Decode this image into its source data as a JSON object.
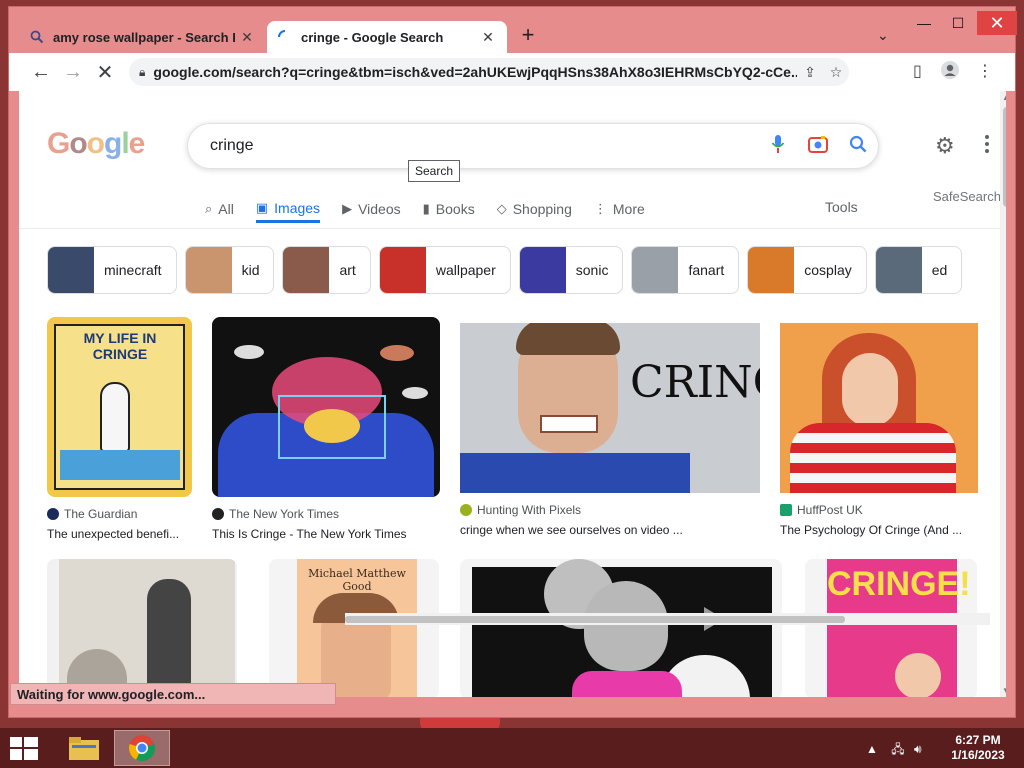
{
  "browser": {
    "tabs": [
      {
        "title": "amy rose wallpaper - Search I",
        "active": false
      },
      {
        "title": "cringe - Google Search",
        "active": true
      }
    ],
    "url": "google.com/search?q=cringe&tbm=isch&ved=2ahUKEwjPqqHSns38AhX8o3IEHRMsCbYQ2-cCe...",
    "status_text": "Waiting for www.google.com..."
  },
  "google": {
    "logo_letters": [
      "G",
      "o",
      "o",
      "g",
      "l",
      "e"
    ],
    "query": "cringe",
    "tooltip": "Search",
    "nav_tabs": [
      {
        "label": "All",
        "icon": "search-icon",
        "active": false
      },
      {
        "label": "Images",
        "icon": "image-icon",
        "active": true
      },
      {
        "label": "Videos",
        "icon": "video-icon",
        "active": false
      },
      {
        "label": "Books",
        "icon": "book-icon",
        "active": false
      },
      {
        "label": "Shopping",
        "icon": "tag-icon",
        "active": false
      },
      {
        "label": "More",
        "icon": "more-vert-icon",
        "active": false
      }
    ],
    "tools_label": "Tools",
    "safesearch_label": "SafeSearch",
    "chips": [
      {
        "label": "minecraft",
        "color": "#3a4a6a"
      },
      {
        "label": "kid",
        "color": "#c9956f"
      },
      {
        "label": "art",
        "color": "#8a5a4a"
      },
      {
        "label": "wallpaper",
        "color": "#c8302a"
      },
      {
        "label": "sonic",
        "color": "#3a3aa0"
      },
      {
        "label": "fanart",
        "color": "#9aa0a8"
      },
      {
        "label": "cosplay",
        "color": "#d97a2a"
      },
      {
        "label": "ed",
        "color": "#5a6a7a"
      }
    ],
    "results": [
      {
        "source": "The Guardian",
        "title": "The unexpected benefi...",
        "thumb_text": "MY LIFE IN CRINGE",
        "src_color": "#1a2a5a"
      },
      {
        "source": "The New York Times",
        "title": "This Is Cringe - The New York Times",
        "thumb_text": "",
        "src_color": "#222222"
      },
      {
        "source": "Hunting With Pixels",
        "title": "cringe when we see ourselves on video ...",
        "thumb_text": "CRINGE",
        "src_color": "#9ab020"
      },
      {
        "source": "HuffPost UK",
        "title": "The Psychology Of Cringe (And ...",
        "thumb_text": "",
        "src_color": "#1aa06a"
      },
      {
        "source": "",
        "title": "",
        "thumb_text": "",
        "src_color": ""
      },
      {
        "source": "",
        "title": "",
        "thumb_text": "Michael Matthew Good",
        "src_color": ""
      },
      {
        "source": "",
        "title": "",
        "thumb_text": "",
        "src_color": ""
      },
      {
        "source": "",
        "title": "",
        "thumb_text": "CRINGE!",
        "src_color": ""
      }
    ]
  },
  "taskbar": {
    "time": "6:27 PM",
    "date": "1/16/2023"
  }
}
